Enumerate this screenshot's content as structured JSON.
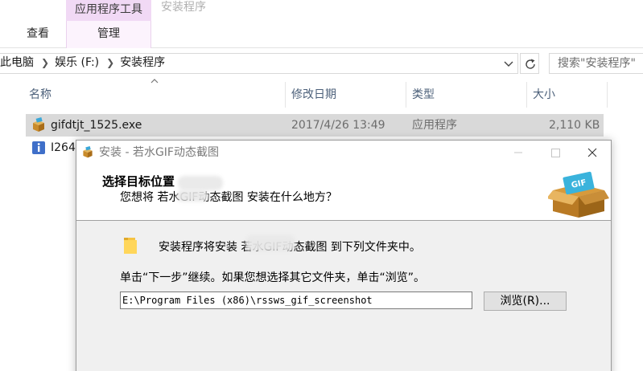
{
  "ribbon": {
    "context_group": "应用程序工具",
    "context_title": "安装程序",
    "tabs": [
      {
        "label": "查看"
      },
      {
        "label": "管理"
      }
    ]
  },
  "address": {
    "crumbs": [
      "此电脑",
      "娱乐 (F:)",
      "安装程序"
    ],
    "search_placeholder": "搜索\"安装程序\""
  },
  "file_list": {
    "columns": [
      "名称",
      "修改日期",
      "类型",
      "大小"
    ],
    "rows": [
      {
        "name": "gifdtjt_1525.exe",
        "modified": "2017/4/26 13:49",
        "type": "应用程序",
        "size": "2,110 KB",
        "selected": true
      },
      {
        "name": "I264",
        "modified": "",
        "type": "",
        "size": "",
        "selected": false
      }
    ]
  },
  "dialog": {
    "title": "安装 - 若水GIF动态截图",
    "header_title": "选择目标位置",
    "header_subtitle": "您想将 若水GIF动态截图 安装在什么地方？",
    "line1": "安装程序将安装 若水GIF动态截图 到下列文件夹中。",
    "line2": "单击“下一步”继续。如果您想选择其它文件夹，单击“浏览”。",
    "path_value": "E:\\Program Files (x86)\\rssws_gif_screenshot",
    "browse_label": "浏览(R)...",
    "logo_badge": "GIF"
  },
  "colors": {
    "context_tab": "#f1d9f5",
    "selected_row": "#d9d9d9",
    "dialog_bg": "#f0f0f0",
    "header_text": "#4c607a"
  },
  "icons": [
    "chevron-down-icon",
    "refresh-icon",
    "sort-up-icon",
    "installer-icon",
    "info-icon",
    "minimize-icon",
    "maximize-icon",
    "close-icon",
    "folder-icon",
    "gif-box-logo"
  ]
}
